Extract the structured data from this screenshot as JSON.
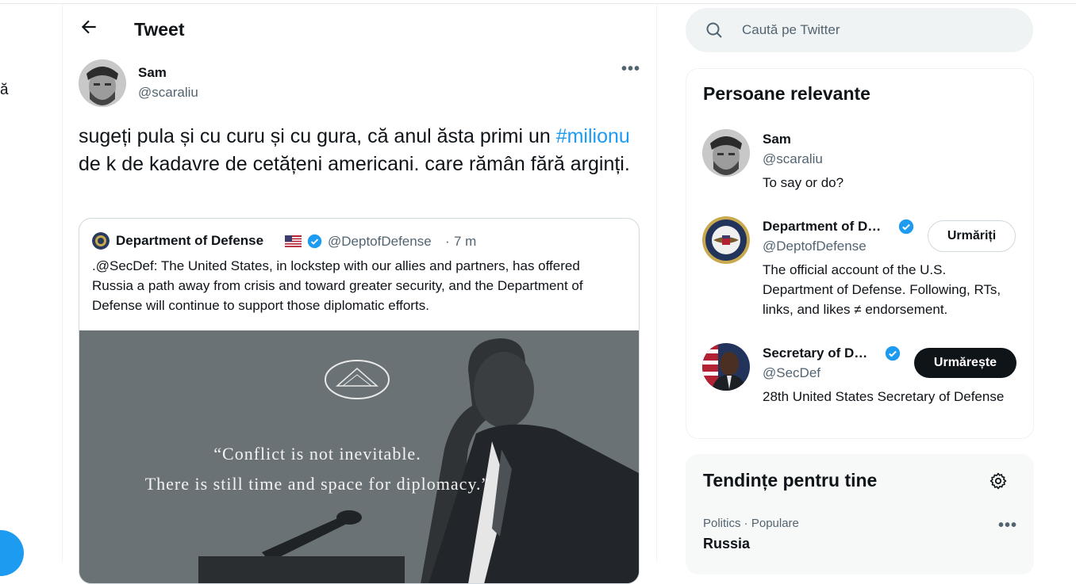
{
  "nav": {
    "cut_label": "ă"
  },
  "header": {
    "title": "Tweet"
  },
  "tweet": {
    "author_name": "Sam",
    "author_handle": "@scaraliu",
    "text_before": "sugeți pula și cu curu și cu gura, că anul ăsta primi un ",
    "hashtag": "#milionu",
    "text_after": " de k de kadavre de cetățeni americani. care rămân fără arginți."
  },
  "quote": {
    "name": "Department of Defense",
    "handle": "@DeptofDefense",
    "separator": "·",
    "time": "7 m",
    "text": ".@SecDef: The United States, in lockstep with our allies and partners, has offered Russia a path away from crisis and toward greater security, and the Department of Defense will continue to support those diplomatic efforts.",
    "media_line1": "“Conflict is not inevitable.",
    "media_line2": "There is still time and space for diplomacy.”"
  },
  "search": {
    "placeholder": "Caută pe Twitter"
  },
  "relevant": {
    "title": "Persoane relevante",
    "people": [
      {
        "name": "Sam",
        "handle": "@scaraliu",
        "bio": "To say or do?"
      },
      {
        "name": "Department of D…",
        "handle": "@DeptofDefense",
        "bio": "The official account of the U.S. Department of Defense. Following, RTs, links, and likes ≠ endorsement.",
        "button": "Urmăriți"
      },
      {
        "name": "Secretary of D…",
        "handle": "@SecDef",
        "bio": "28th United States Secretary of Defense",
        "button": "Urmărește"
      }
    ]
  },
  "trends": {
    "title": "Tendințe pentru tine",
    "items": [
      {
        "category": "Politics · Populare",
        "name": "Russia",
        "count": ""
      }
    ]
  },
  "colors": {
    "accent": "#1d9bf0",
    "text": "#0f1419",
    "muted": "#536471",
    "dark_button": "#0f1419"
  }
}
